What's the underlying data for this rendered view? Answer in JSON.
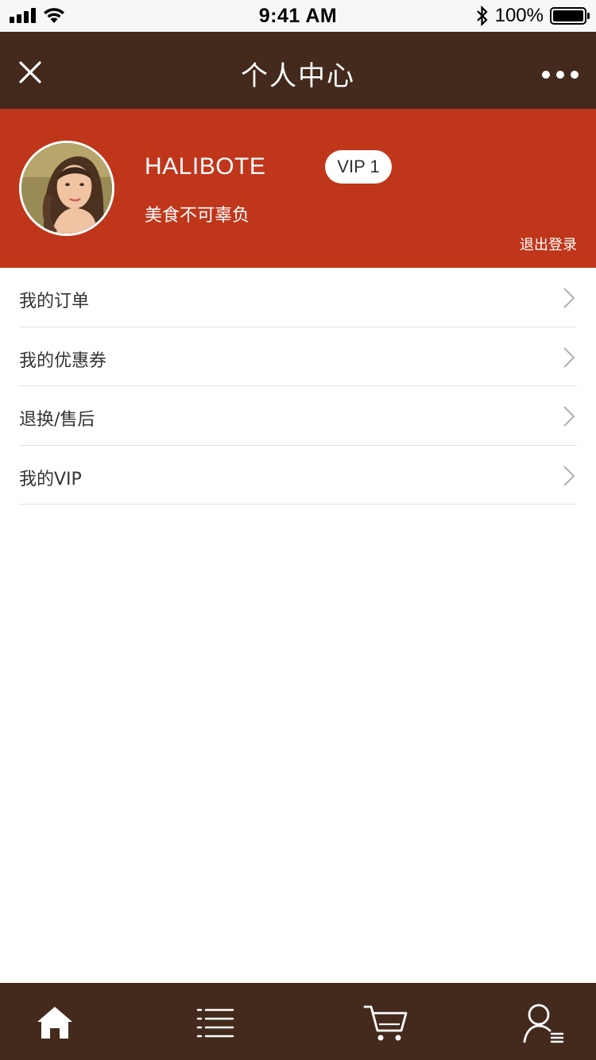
{
  "status_bar": {
    "time": "9:41 AM",
    "battery": "100%",
    "icons": [
      "signal-icon",
      "wifi-icon",
      "bluetooth-icon",
      "battery-icon"
    ]
  },
  "nav": {
    "title": "个人中心",
    "left_icon": "close-icon",
    "right_icon": "more-icon"
  },
  "profile": {
    "username": "HALIBOTE",
    "vip_level": "VIP 1",
    "signature": "美食不可辜负",
    "logout_label": "退出登录"
  },
  "menu": {
    "items": [
      {
        "label": "我的订单"
      },
      {
        "label": "我的优惠券"
      },
      {
        "label": "退换/售后"
      },
      {
        "label": "我的VIP"
      }
    ]
  },
  "tab_bar": {
    "tabs": [
      "home-icon",
      "list-icon",
      "cart-icon",
      "profile-icon"
    ]
  },
  "colors": {
    "nav_bg": "#432a1d",
    "profile_bg": "#c0361b",
    "divider": "#e3e3e3",
    "arrow": "#b0b0b0"
  }
}
